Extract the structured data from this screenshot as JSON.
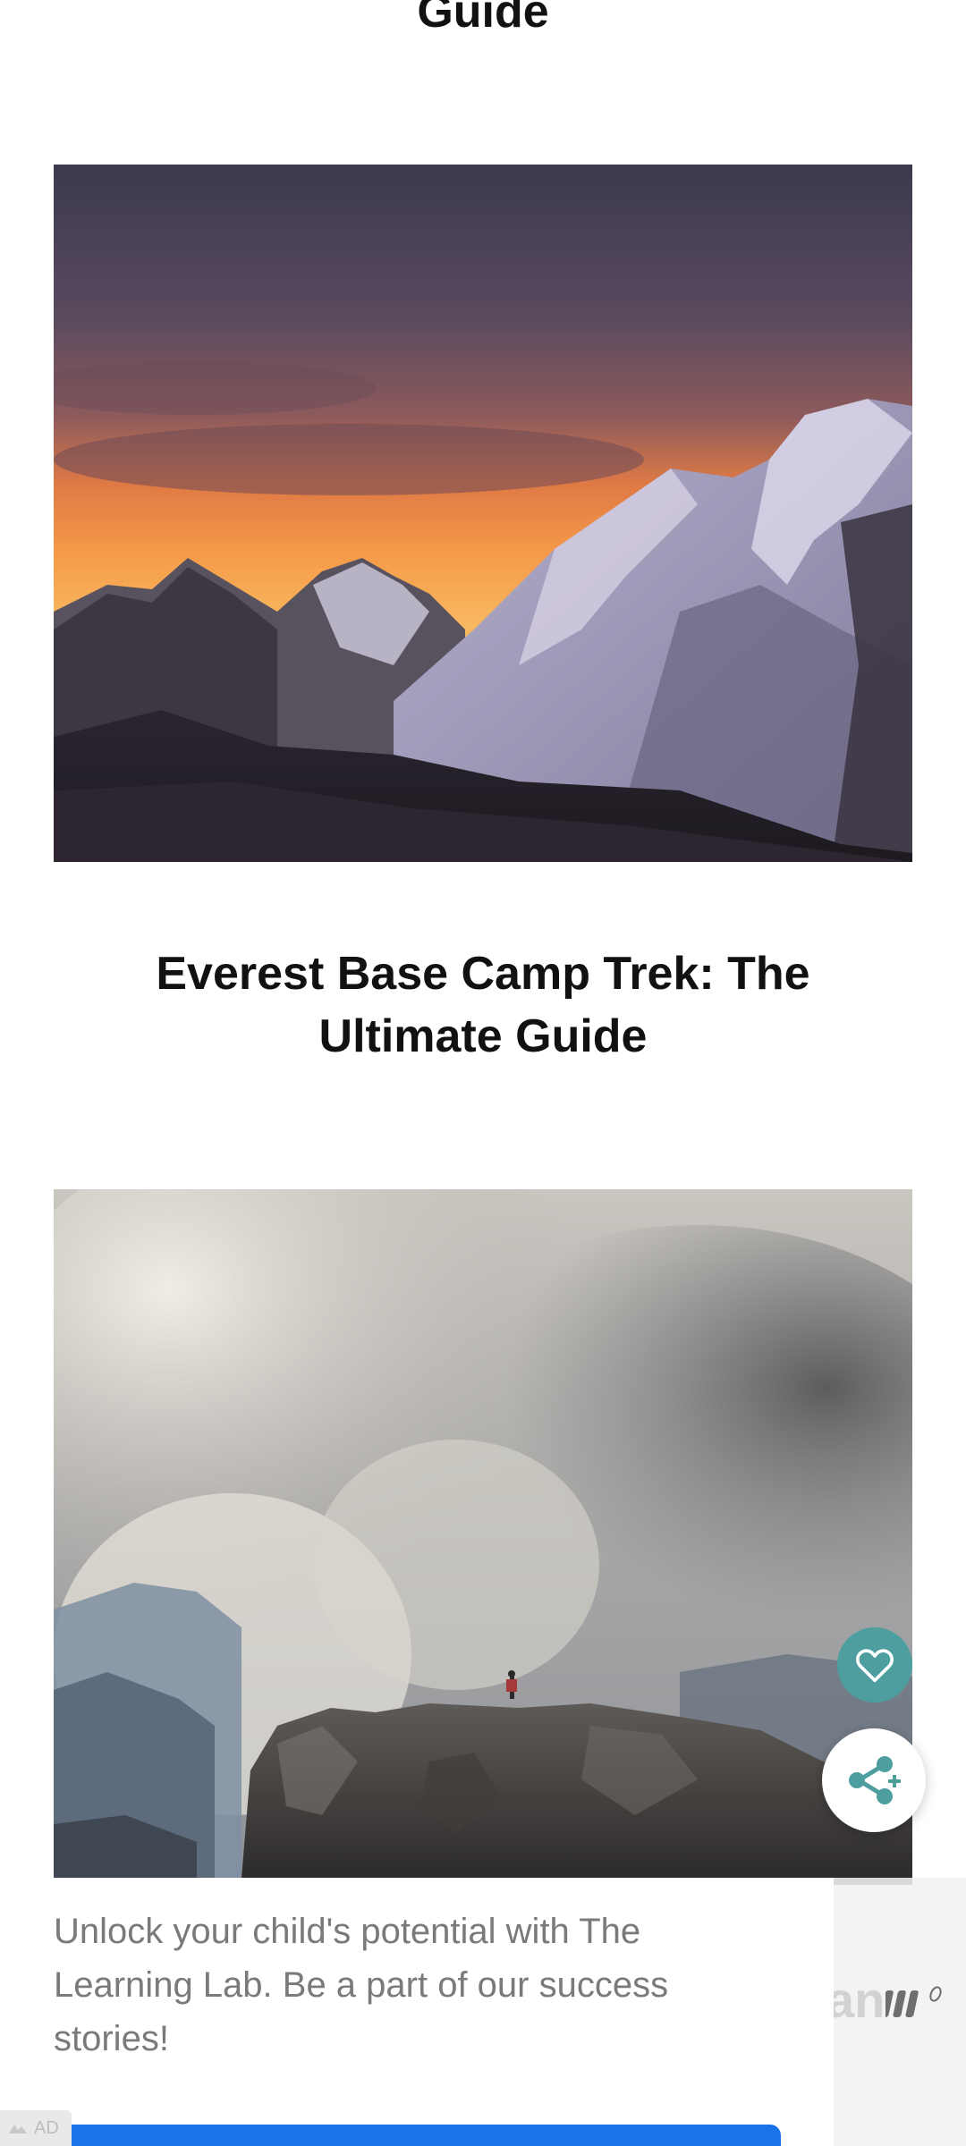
{
  "articles": {
    "previous_title_tail": "Guide",
    "featured_title": "Everest Base Camp Trek: The Ultimate Guide"
  },
  "images": {
    "everest": "mountain-sunset-photo",
    "volcano": "volcano-smoke-hiker-photo"
  },
  "actions": {
    "like_icon": "heart-icon",
    "share_icon": "share-icon",
    "like_color": "#4e9ea0"
  },
  "ad": {
    "text": "Unlock your child's potential with The Learning Lab. Be a part of our success stories!",
    "brand_partial": "an",
    "badge_label": "AD",
    "cta_color": "#1a73e8"
  }
}
